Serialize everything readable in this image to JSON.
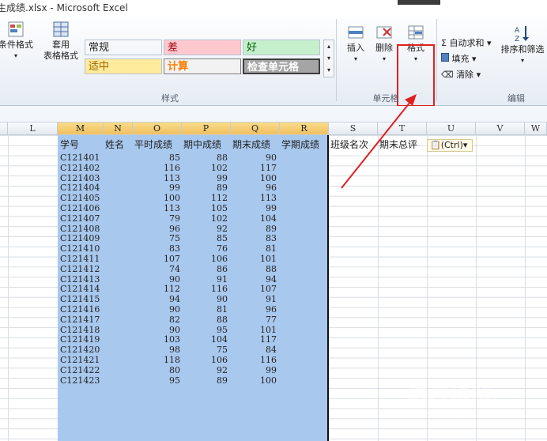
{
  "window": {
    "title": "生成绩.xlsx - Microsoft Excel"
  },
  "ribbon": {
    "conditional_format_label": "条件格式",
    "format_as_table_label_1": "套用",
    "format_as_table_label_2": "表格格式",
    "styles": [
      {
        "label": "常规",
        "bg": "#ffffff",
        "fg": "#222222"
      },
      {
        "label": "差",
        "bg": "#ffc7ce",
        "fg": "#9c0006"
      },
      {
        "label": "好",
        "bg": "#c6efce",
        "fg": "#006100"
      },
      {
        "label": "适中",
        "bg": "#ffeb9c",
        "fg": "#9c6500"
      },
      {
        "label": "计算",
        "bg": "#f2f2f2",
        "fg": "#fa7d00"
      },
      {
        "label": "检查单元格",
        "bg": "#a5a5a5",
        "fg": "#ffffff"
      }
    ],
    "styles_group_label": "样式",
    "insert_label": "插入",
    "delete_label": "删除",
    "format_label": "格式",
    "cells_group_label": "单元格",
    "autosum_label": "Σ 自动求和",
    "fill_label": "填充",
    "clear_label": "清除",
    "sort_filter_label": "排序和筛选",
    "editing_group_label": "编辑"
  },
  "columns": [
    "L",
    "M",
    "N",
    "O",
    "P",
    "Q",
    "R",
    "S",
    "T",
    "U",
    "V",
    "W"
  ],
  "headers": {
    "M": "学号",
    "N": "姓名",
    "O": "平时成绩",
    "P": "期中成绩",
    "Q": "期末成绩",
    "R": "学期成绩",
    "S": "班级名次",
    "T": "期末总评"
  },
  "paste_options_label": "(Ctrl)",
  "rows": [
    {
      "id": "C121401",
      "o": "85",
      "p": "88",
      "q": "90"
    },
    {
      "id": "C121402",
      "o": "116",
      "p": "102",
      "q": "117"
    },
    {
      "id": "C121403",
      "o": "113",
      "p": "99",
      "q": "100"
    },
    {
      "id": "C121404",
      "o": "99",
      "p": "89",
      "q": "96"
    },
    {
      "id": "C121405",
      "o": "100",
      "p": "112",
      "q": "113"
    },
    {
      "id": "C121406",
      "o": "113",
      "p": "105",
      "q": "99"
    },
    {
      "id": "C121407",
      "o": "79",
      "p": "102",
      "q": "104"
    },
    {
      "id": "C121408",
      "o": "96",
      "p": "92",
      "q": "89"
    },
    {
      "id": "C121409",
      "o": "75",
      "p": "85",
      "q": "83"
    },
    {
      "id": "C121410",
      "o": "83",
      "p": "76",
      "q": "81"
    },
    {
      "id": "C121411",
      "o": "107",
      "p": "106",
      "q": "101"
    },
    {
      "id": "C121412",
      "o": "74",
      "p": "86",
      "q": "88"
    },
    {
      "id": "C121413",
      "o": "90",
      "p": "91",
      "q": "94"
    },
    {
      "id": "C121414",
      "o": "112",
      "p": "116",
      "q": "107"
    },
    {
      "id": "C121415",
      "o": "94",
      "p": "90",
      "q": "91"
    },
    {
      "id": "C121416",
      "o": "90",
      "p": "81",
      "q": "96"
    },
    {
      "id": "C121417",
      "o": "82",
      "p": "88",
      "q": "77"
    },
    {
      "id": "C121418",
      "o": "90",
      "p": "95",
      "q": "101"
    },
    {
      "id": "C121419",
      "o": "103",
      "p": "104",
      "q": "117"
    },
    {
      "id": "C121420",
      "o": "98",
      "p": "75",
      "q": "84"
    },
    {
      "id": "C121421",
      "o": "118",
      "p": "106",
      "q": "116"
    },
    {
      "id": "C121422",
      "o": "80",
      "p": "92",
      "q": "99"
    },
    {
      "id": "C121423",
      "o": "95",
      "p": "89",
      "q": "100"
    }
  ],
  "watermark": {
    "title": "搜狗指南",
    "url": "zhinan.sogou.com"
  }
}
